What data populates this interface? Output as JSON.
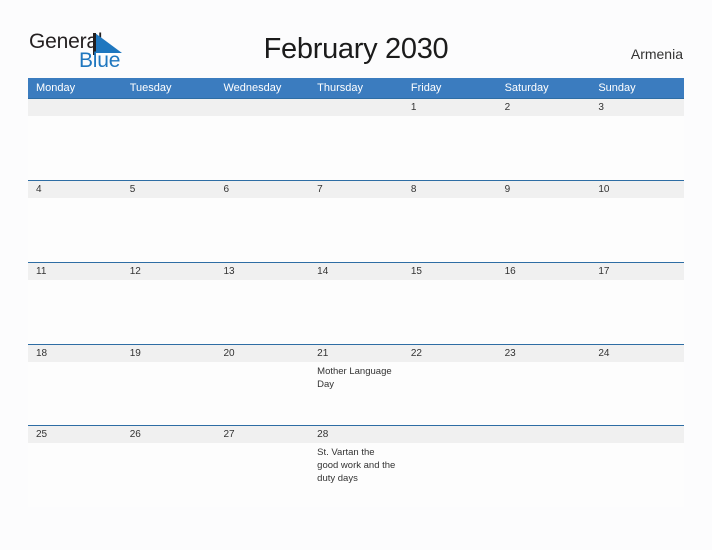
{
  "brand": {
    "name_part1": "General",
    "name_part2": "Blue",
    "accent_color": "#1f77bf",
    "triangle_icon": "triangle-icon"
  },
  "header": {
    "title": "February 2030",
    "country": "Armenia"
  },
  "calendar": {
    "header_bg": "#3b7cbf",
    "date_band_bg": "#f0f0f0",
    "date_band_border": "#2e6da4",
    "weekdays": [
      "Monday",
      "Tuesday",
      "Wednesday",
      "Thursday",
      "Friday",
      "Saturday",
      "Sunday"
    ],
    "weeks": [
      {
        "dates": [
          "",
          "",
          "",
          "",
          "1",
          "2",
          "3"
        ],
        "events": [
          "",
          "",
          "",
          "",
          "",
          "",
          ""
        ]
      },
      {
        "dates": [
          "4",
          "5",
          "6",
          "7",
          "8",
          "9",
          "10"
        ],
        "events": [
          "",
          "",
          "",
          "",
          "",
          "",
          ""
        ]
      },
      {
        "dates": [
          "11",
          "12",
          "13",
          "14",
          "15",
          "16",
          "17"
        ],
        "events": [
          "",
          "",
          "",
          "",
          "",
          "",
          ""
        ]
      },
      {
        "dates": [
          "18",
          "19",
          "20",
          "21",
          "22",
          "23",
          "24"
        ],
        "events": [
          "",
          "",
          "",
          "Mother Language Day",
          "",
          "",
          ""
        ]
      },
      {
        "dates": [
          "25",
          "26",
          "27",
          "28",
          "",
          "",
          ""
        ],
        "events": [
          "",
          "",
          "",
          "St. Vartan the good work and the duty days",
          "",
          "",
          ""
        ]
      }
    ]
  }
}
